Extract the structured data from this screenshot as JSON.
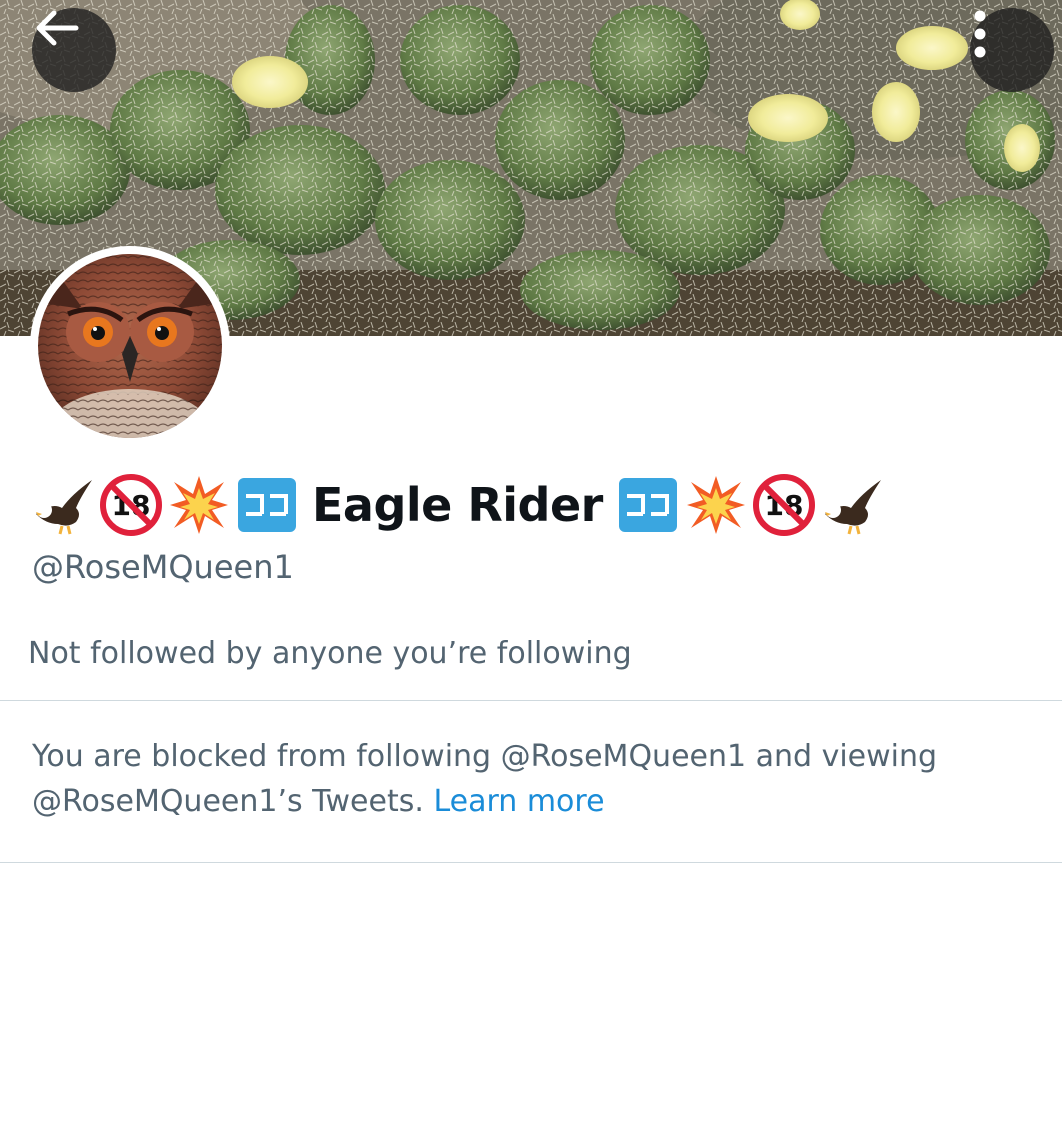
{
  "header": {
    "back_icon": "arrow-left-icon",
    "more_icon": "more-vertical-icon"
  },
  "profile": {
    "display_name": "Eagle Rider",
    "name_emoji_left": [
      "eagle-emoji",
      "no-under-18-emoji",
      "collision-emoji",
      "koko-emoji"
    ],
    "name_emoji_right": [
      "koko-emoji",
      "collision-emoji",
      "no-under-18-emoji",
      "eagle-emoji"
    ],
    "handle": "@RoseMQueen1",
    "followers_note": "Not followed by anyone you’re following"
  },
  "blocked": {
    "message": "You are blocked from following @RoseMQueen1 and viewing @RoseMQueen1’s Tweets.",
    "link_label": "Learn more"
  },
  "colors": {
    "primary_text": "#0f1419",
    "secondary_text": "#536471",
    "link": "#1a8cd8",
    "divider": "#cfd9de"
  }
}
